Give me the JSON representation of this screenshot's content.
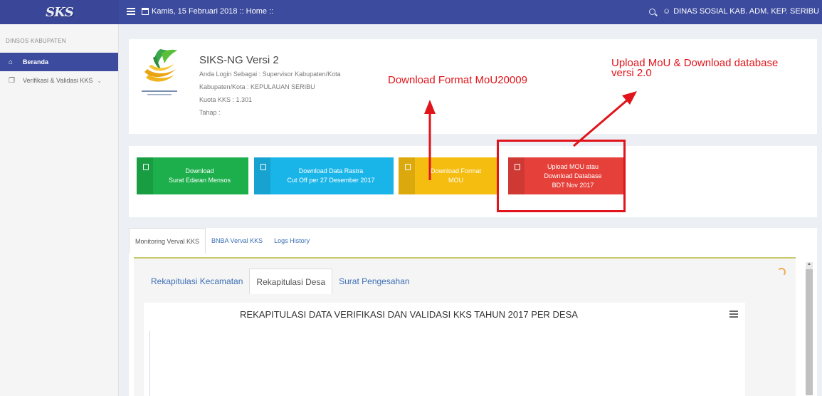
{
  "topbar": {
    "logo": "SKS",
    "date_text": "Kamis, 15 Februari 2018 :: Home ::",
    "user": "DINAS SOSIAL KAB. ADM. KEP. SERIBU"
  },
  "sidebar": {
    "header": "DINSOS KABUPATEN",
    "items": [
      {
        "label": "Beranda",
        "icon": "home-icon",
        "active": true
      },
      {
        "label": "Verifikasi & Validasi KKS",
        "icon": "copy-icon",
        "active": false
      }
    ]
  },
  "profile": {
    "title": "SIKS-NG Versi 2",
    "login_as": "Anda Login Sebagai : Supervisor Kabupaten/Kota",
    "region": "Kabupaten/Kota : KEPULAUAN SERIBU",
    "quota": "Kuota KKS : 1.301",
    "stage": "Tahap :"
  },
  "buttons": [
    {
      "line1": "Download",
      "line2": "Surat Edaran Mensos",
      "color": "#1caf4b"
    },
    {
      "line1": "Download Data Rastra",
      "line2": "Cut Off per 27 Desember 2017",
      "color": "#1ab5e8"
    },
    {
      "line1": "Download Format",
      "line2": "MOU",
      "color": "#f4bd10"
    },
    {
      "line1": "Upload MOU atau",
      "line2": "Download Database",
      "line3": "BDT Nov 2017",
      "color": "#e6403a"
    }
  ],
  "tabs": [
    "Monitoring Verval KKS",
    "BNBA Verval KKS",
    "Logs History"
  ],
  "sub_tabs": [
    "Rekapitulasi Kecamatan",
    "Rekapitulasi Desa",
    "Surat Pengesahan"
  ],
  "chart": {
    "title": "REKAPITULASI DATA VERIFIKASI DAN VALIDASI KKS TAHUN 2017 PER DESA"
  },
  "annotations": {
    "download_format": "Download Format MoU20009",
    "upload_line1": "Upload MoU & Download database",
    "upload_line2": "versi 2.0",
    "color": "#e0141a"
  }
}
